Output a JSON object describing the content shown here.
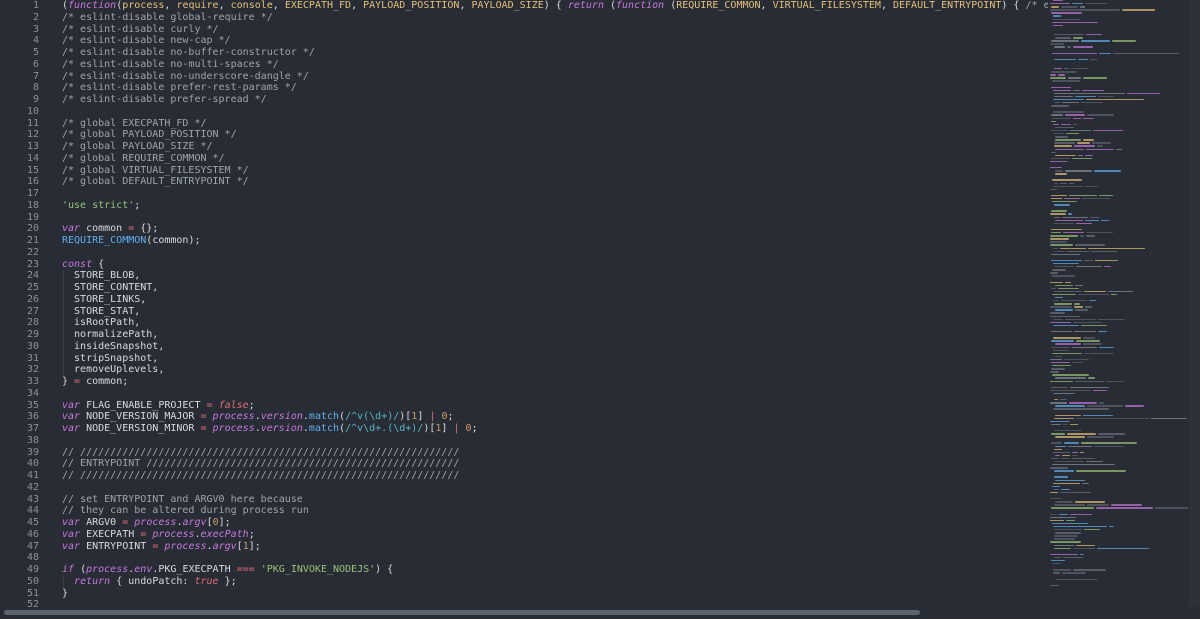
{
  "editor": {
    "lines": [
      {
        "n": "1",
        "tokens": [
          [
            "(",
            "t-punct"
          ],
          [
            "function",
            "t-keyword"
          ],
          [
            "(",
            "t-punct"
          ],
          [
            "process",
            "t-param"
          ],
          [
            ", ",
            "t-punct"
          ],
          [
            "require",
            "t-param"
          ],
          [
            ", ",
            "t-punct"
          ],
          [
            "console",
            "t-param"
          ],
          [
            ", ",
            "t-punct"
          ],
          [
            "EXECPATH_FD",
            "t-param"
          ],
          [
            ", ",
            "t-punct"
          ],
          [
            "PAYLOAD_POSITION",
            "t-param"
          ],
          [
            ", ",
            "t-punct"
          ],
          [
            "PAYLOAD_SIZE",
            "t-param"
          ],
          [
            ") { ",
            "t-punct"
          ],
          [
            "return",
            "t-keyword"
          ],
          [
            " (",
            "t-punct"
          ],
          [
            "function",
            "t-keyword"
          ],
          [
            " (",
            "t-punct"
          ],
          [
            "REQUIRE_COMMON",
            "t-param"
          ],
          [
            ", ",
            "t-punct"
          ],
          [
            "VIRTUAL_FILESYSTEM",
            "t-param"
          ],
          [
            ", ",
            "t-punct"
          ],
          [
            "DEFAULT_ENTRYPOINT",
            "t-param"
          ],
          [
            ") { ",
            "t-punct"
          ],
          [
            "/* eslint-disable imp",
            "t-comment"
          ]
        ]
      },
      {
        "n": "2",
        "tokens": [
          [
            "/* eslint-disable global-require */",
            "t-comment"
          ]
        ]
      },
      {
        "n": "3",
        "tokens": [
          [
            "/* eslint-disable curly */",
            "t-comment"
          ]
        ]
      },
      {
        "n": "4",
        "tokens": [
          [
            "/* eslint-disable new-cap */",
            "t-comment"
          ]
        ]
      },
      {
        "n": "5",
        "tokens": [
          [
            "/* eslint-disable no-buffer-constructor */",
            "t-comment"
          ]
        ]
      },
      {
        "n": "6",
        "tokens": [
          [
            "/* eslint-disable no-multi-spaces */",
            "t-comment"
          ]
        ]
      },
      {
        "n": "7",
        "tokens": [
          [
            "/* eslint-disable no-underscore-dangle */",
            "t-comment"
          ]
        ]
      },
      {
        "n": "8",
        "tokens": [
          [
            "/* eslint-disable prefer-rest-params */",
            "t-comment"
          ]
        ]
      },
      {
        "n": "9",
        "tokens": [
          [
            "/* eslint-disable prefer-spread */",
            "t-comment"
          ]
        ]
      },
      {
        "n": "10",
        "tokens": []
      },
      {
        "n": "11",
        "tokens": [
          [
            "/* global EXECPATH_FD */",
            "t-comment"
          ]
        ]
      },
      {
        "n": "12",
        "tokens": [
          [
            "/* global PAYLOAD_POSITION */",
            "t-comment"
          ]
        ]
      },
      {
        "n": "13",
        "tokens": [
          [
            "/* global PAYLOAD_SIZE */",
            "t-comment"
          ]
        ]
      },
      {
        "n": "14",
        "tokens": [
          [
            "/* global REQUIRE_COMMON */",
            "t-comment"
          ]
        ]
      },
      {
        "n": "15",
        "tokens": [
          [
            "/* global VIRTUAL_FILESYSTEM */",
            "t-comment"
          ]
        ]
      },
      {
        "n": "16",
        "tokens": [
          [
            "/* global DEFAULT_ENTRYPOINT */",
            "t-comment"
          ]
        ]
      },
      {
        "n": "17",
        "tokens": []
      },
      {
        "n": "18",
        "tokens": [
          [
            "'use strict'",
            "t-string"
          ],
          [
            ";",
            "t-punct"
          ]
        ]
      },
      {
        "n": "19",
        "tokens": []
      },
      {
        "n": "20",
        "tokens": [
          [
            "var",
            "t-keyword"
          ],
          [
            " common ",
            "t-plain"
          ],
          [
            "=",
            "t-operator"
          ],
          [
            " {};",
            "t-punct"
          ]
        ]
      },
      {
        "n": "21",
        "tokens": [
          [
            "REQUIRE_COMMON",
            "t-func"
          ],
          [
            "(common);",
            "t-punct"
          ]
        ]
      },
      {
        "n": "22",
        "tokens": []
      },
      {
        "n": "23",
        "tokens": [
          [
            "const",
            "t-keyword"
          ],
          [
            " {",
            "t-punct"
          ]
        ]
      },
      {
        "n": "24",
        "guide": true,
        "tokens": [
          [
            "  STORE_BLOB,",
            "t-plain"
          ]
        ]
      },
      {
        "n": "25",
        "guide": true,
        "tokens": [
          [
            "  STORE_CONTENT,",
            "t-plain"
          ]
        ]
      },
      {
        "n": "26",
        "guide": true,
        "tokens": [
          [
            "  STORE_LINKS,",
            "t-plain"
          ]
        ]
      },
      {
        "n": "27",
        "guide": true,
        "tokens": [
          [
            "  STORE_STAT,",
            "t-plain"
          ]
        ]
      },
      {
        "n": "28",
        "guide": true,
        "tokens": [
          [
            "  isRootPath,",
            "t-plain"
          ]
        ]
      },
      {
        "n": "29",
        "guide": true,
        "tokens": [
          [
            "  normalizePath,",
            "t-plain"
          ]
        ]
      },
      {
        "n": "30",
        "guide": true,
        "tokens": [
          [
            "  insideSnapshot,",
            "t-plain"
          ]
        ]
      },
      {
        "n": "31",
        "guide": true,
        "tokens": [
          [
            "  stripSnapshot,",
            "t-plain"
          ]
        ]
      },
      {
        "n": "32",
        "guide": true,
        "tokens": [
          [
            "  removeUplevels,",
            "t-plain"
          ]
        ]
      },
      {
        "n": "33",
        "tokens": [
          [
            "} ",
            "t-punct"
          ],
          [
            "=",
            "t-operator"
          ],
          [
            " common;",
            "t-plain"
          ]
        ]
      },
      {
        "n": "34",
        "tokens": []
      },
      {
        "n": "35",
        "tokens": [
          [
            "var",
            "t-keyword"
          ],
          [
            " FLAG_ENABLE_PROJECT ",
            "t-plain"
          ],
          [
            "=",
            "t-operator"
          ],
          [
            " ",
            "t-plain"
          ],
          [
            "false",
            "t-bool"
          ],
          [
            ";",
            "t-punct"
          ]
        ]
      },
      {
        "n": "36",
        "tokens": [
          [
            "var",
            "t-keyword"
          ],
          [
            " NODE_VERSION_MAJOR ",
            "t-plain"
          ],
          [
            "=",
            "t-operator"
          ],
          [
            " ",
            "t-plain"
          ],
          [
            "process",
            "t-italic"
          ],
          [
            ".",
            "t-punct"
          ],
          [
            "version",
            "t-italic"
          ],
          [
            ".",
            "t-punct"
          ],
          [
            "match",
            "t-func"
          ],
          [
            "(",
            "t-punct"
          ],
          [
            "/^v(\\d+)/",
            "t-regex"
          ],
          [
            ")[",
            "t-punct"
          ],
          [
            "1",
            "t-number"
          ],
          [
            "] ",
            "t-punct"
          ],
          [
            "|",
            "t-operator"
          ],
          [
            " ",
            "t-plain"
          ],
          [
            "0",
            "t-number"
          ],
          [
            ";",
            "t-punct"
          ]
        ]
      },
      {
        "n": "37",
        "tokens": [
          [
            "var",
            "t-keyword"
          ],
          [
            " NODE_VERSION_MINOR ",
            "t-plain"
          ],
          [
            "=",
            "t-operator"
          ],
          [
            " ",
            "t-plain"
          ],
          [
            "process",
            "t-italic"
          ],
          [
            ".",
            "t-punct"
          ],
          [
            "version",
            "t-italic"
          ],
          [
            ".",
            "t-punct"
          ],
          [
            "match",
            "t-func"
          ],
          [
            "(",
            "t-punct"
          ],
          [
            "/^v\\d+.(\\d+)/",
            "t-regex"
          ],
          [
            ")[",
            "t-punct"
          ],
          [
            "1",
            "t-number"
          ],
          [
            "] ",
            "t-punct"
          ],
          [
            "|",
            "t-operator"
          ],
          [
            " ",
            "t-plain"
          ],
          [
            "0",
            "t-number"
          ],
          [
            ";",
            "t-punct"
          ]
        ]
      },
      {
        "n": "38",
        "tokens": []
      },
      {
        "n": "39",
        "tokens": [
          [
            "// ///////////////////////////////////////////////////////////////",
            "t-comment"
          ]
        ]
      },
      {
        "n": "40",
        "tokens": [
          [
            "// ENTRYPOINT ////////////////////////////////////////////////////",
            "t-comment"
          ]
        ]
      },
      {
        "n": "41",
        "tokens": [
          [
            "// ///////////////////////////////////////////////////////////////",
            "t-comment"
          ]
        ]
      },
      {
        "n": "42",
        "tokens": []
      },
      {
        "n": "43",
        "tokens": [
          [
            "// set ENTRYPOINT and ARGV0 here because",
            "t-comment"
          ]
        ]
      },
      {
        "n": "44",
        "tokens": [
          [
            "// they can be altered during process run",
            "t-comment"
          ]
        ]
      },
      {
        "n": "45",
        "tokens": [
          [
            "var",
            "t-keyword"
          ],
          [
            " ARGV0 ",
            "t-plain"
          ],
          [
            "=",
            "t-operator"
          ],
          [
            " ",
            "t-plain"
          ],
          [
            "process",
            "t-italic"
          ],
          [
            ".",
            "t-punct"
          ],
          [
            "argv",
            "t-italic"
          ],
          [
            "[",
            "t-punct"
          ],
          [
            "0",
            "t-number"
          ],
          [
            "];",
            "t-punct"
          ]
        ]
      },
      {
        "n": "46",
        "tokens": [
          [
            "var",
            "t-keyword"
          ],
          [
            " EXECPATH ",
            "t-plain"
          ],
          [
            "=",
            "t-operator"
          ],
          [
            " ",
            "t-plain"
          ],
          [
            "process",
            "t-italic"
          ],
          [
            ".",
            "t-punct"
          ],
          [
            "execPath",
            "t-italic"
          ],
          [
            ";",
            "t-punct"
          ]
        ]
      },
      {
        "n": "47",
        "tokens": [
          [
            "var",
            "t-keyword"
          ],
          [
            " ENTRYPOINT ",
            "t-plain"
          ],
          [
            "=",
            "t-operator"
          ],
          [
            " ",
            "t-plain"
          ],
          [
            "process",
            "t-italic"
          ],
          [
            ".",
            "t-punct"
          ],
          [
            "argv",
            "t-italic"
          ],
          [
            "[",
            "t-punct"
          ],
          [
            "1",
            "t-number"
          ],
          [
            "];",
            "t-punct"
          ]
        ]
      },
      {
        "n": "48",
        "tokens": []
      },
      {
        "n": "49",
        "tokens": [
          [
            "if",
            "t-keyword"
          ],
          [
            " (",
            "t-punct"
          ],
          [
            "process",
            "t-italic"
          ],
          [
            ".",
            "t-punct"
          ],
          [
            "env",
            "t-italic"
          ],
          [
            ".PKG_EXECPATH ",
            "t-plain"
          ],
          [
            "===",
            "t-operator"
          ],
          [
            " ",
            "t-plain"
          ],
          [
            "'PKG_INVOKE_NODEJS'",
            "t-string"
          ],
          [
            ") {",
            "t-punct"
          ]
        ]
      },
      {
        "n": "50",
        "guide": true,
        "tokens": [
          [
            "  ",
            "t-plain"
          ],
          [
            "return",
            "t-keyword"
          ],
          [
            " { undoPatch: ",
            "t-plain"
          ],
          [
            "true",
            "t-bool"
          ],
          [
            " };",
            "t-punct"
          ]
        ]
      },
      {
        "n": "51",
        "tokens": [
          [
            "}",
            "t-punct"
          ]
        ]
      },
      {
        "n": "52",
        "tokens": []
      }
    ]
  },
  "colors": {
    "background": "#282c34",
    "keyword": "#c678dd",
    "param": "#e5c07b",
    "comment": "#9ea4ad",
    "string": "#98c379",
    "function": "#61afef",
    "number": "#d19a66",
    "operator": "#e06c75",
    "regex": "#56b6c2"
  },
  "minimap": {
    "icon": "minimap-code-preview"
  },
  "scrollbar": {
    "horizontal_position": 0.0,
    "horizontal_visible_fraction": 0.77
  }
}
